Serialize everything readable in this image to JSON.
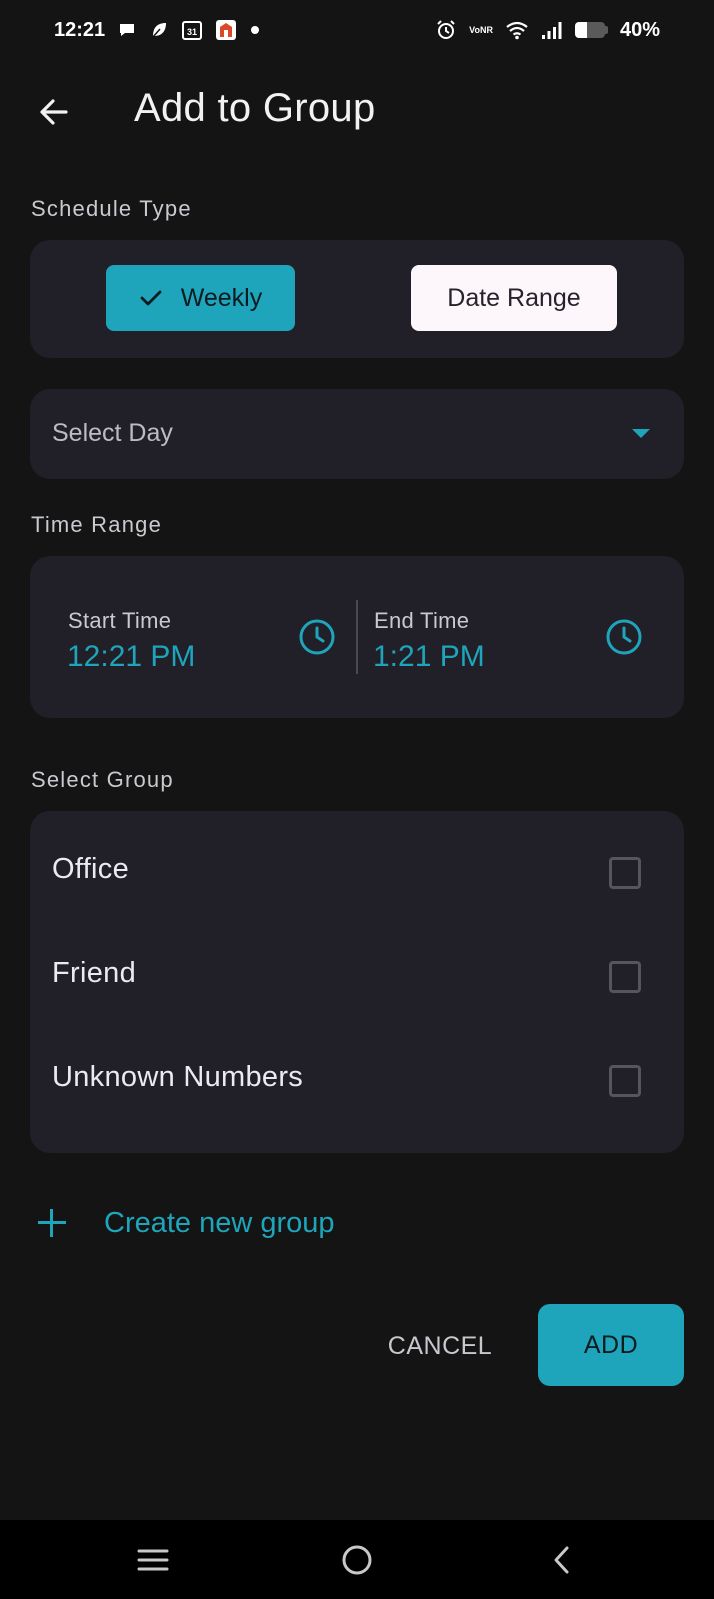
{
  "status_bar": {
    "time": "12:21",
    "calendar_day": "31",
    "network_label_top": "Vo",
    "network_label_bottom": "NR",
    "battery_percent": "40%",
    "battery_level": 0.4
  },
  "app_bar": {
    "title": "Add to Group",
    "back_icon": "arrow-left-icon"
  },
  "schedule_type": {
    "label": "Schedule Type",
    "options": [
      {
        "label": "Weekly",
        "selected": true
      },
      {
        "label": "Date Range",
        "selected": false
      }
    ]
  },
  "day_select": {
    "placeholder": "Select Day"
  },
  "time_range": {
    "label": "Time Range",
    "start": {
      "label": "Start Time",
      "value": "12:21 PM"
    },
    "end": {
      "label": "End Time",
      "value": "1:21 PM"
    }
  },
  "groups": {
    "label": "Select Group",
    "items": [
      {
        "name": "Office",
        "checked": false
      },
      {
        "name": "Friend",
        "checked": false
      },
      {
        "name": "Unknown Numbers",
        "checked": false
      }
    ],
    "create_label": "Create new group"
  },
  "actions": {
    "cancel_label": "CANCEL",
    "add_label": "ADD"
  },
  "colors": {
    "accent": "#1ea5bb",
    "background": "#141414",
    "card": "#211f28"
  }
}
